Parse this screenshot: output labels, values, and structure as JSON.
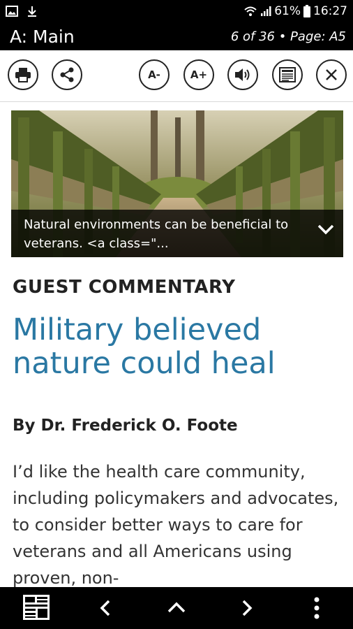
{
  "status": {
    "battery": "61%",
    "time": "16:27"
  },
  "header": {
    "section": "A: Main",
    "position": "6 of 36 • Page: A5"
  },
  "toolbar": {
    "decrease_font_label": "A-",
    "increase_font_label": "A+"
  },
  "article": {
    "caption": "Natural environments can be beneficial to veterans.  <a class=\"...",
    "kicker": "GUEST COMMENTARY",
    "headline": "Military believed nature could heal",
    "byline": "By Dr. Frederick O. Foote",
    "body": "I’d like the health care community, including policymakers and advocates, to consider better ways to care for veterans and all Americans using proven, non-"
  },
  "icons": {
    "status_left": [
      "image-icon",
      "download-icon"
    ],
    "status_right": [
      "wifi-icon",
      "signal-icon",
      "battery-icon"
    ],
    "toolbar": [
      "print-icon",
      "share-icon",
      "font-decrease-icon",
      "font-increase-icon",
      "speaker-icon",
      "article-view-icon",
      "close-icon"
    ],
    "bottom": [
      "page-view-icon",
      "chevron-left-icon",
      "chevron-up-icon",
      "chevron-right-icon",
      "more-vertical-icon"
    ]
  },
  "colors": {
    "bar_background": "#000000",
    "headline": "#2a78a3",
    "text": "#222222"
  }
}
